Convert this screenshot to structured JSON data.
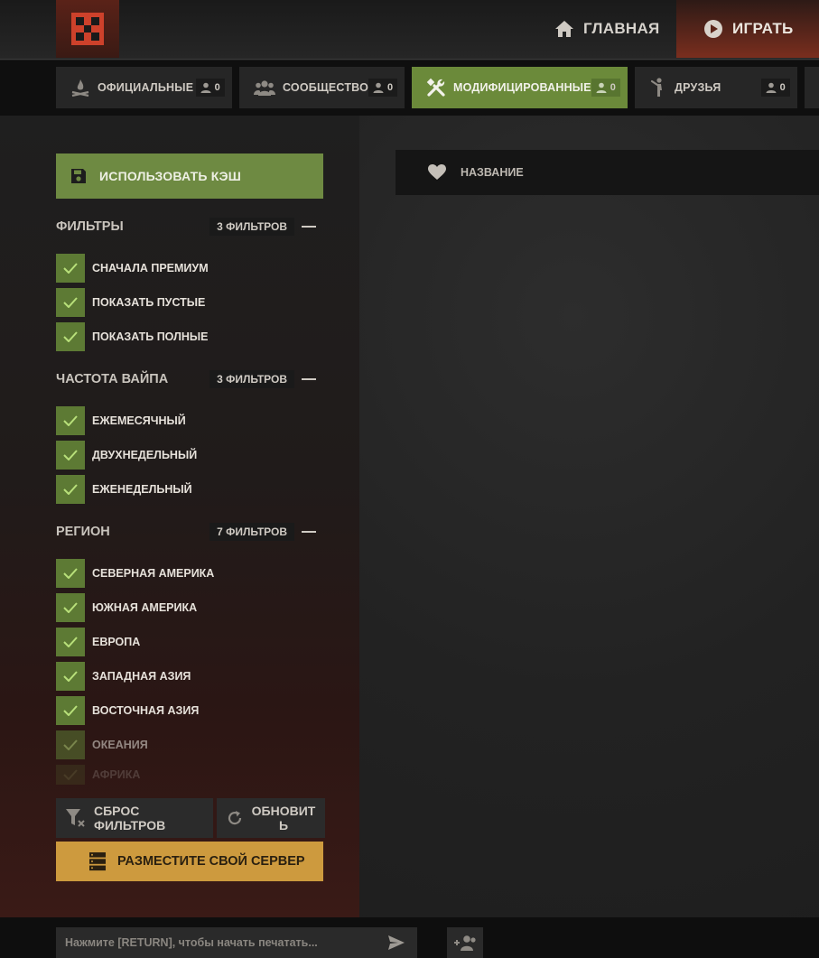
{
  "header": {
    "home_label": "ГЛАВНАЯ",
    "play_label": "ИГРАТЬ",
    "accent": "#cd412b"
  },
  "tabs": [
    {
      "label": "ОФИЦИАЛЬНЫЕ",
      "count": "0",
      "icon": "campfire-icon"
    },
    {
      "label": "СООБЩЕСТВО",
      "count": "0",
      "icon": "people-icon"
    },
    {
      "label": "МОДИФИЦИРОВАННЫЕ",
      "count": "0",
      "icon": "tools-icon",
      "active": true
    },
    {
      "label": "ДРУЗЬЯ",
      "count": "0",
      "icon": "waving-person-icon"
    }
  ],
  "sidebar": {
    "cache_button": "ИСПОЛЬЗОВАТЬ КЭШ",
    "filter_groups": [
      {
        "title": "ФИЛЬТРЫ",
        "count_label": "3 ФИЛЬТРОВ",
        "items": [
          "СНАЧАЛА ПРЕМИУМ",
          "ПОКАЗАТЬ ПУСТЫЕ",
          "ПОКАЗАТЬ ПОЛНЫЕ"
        ]
      },
      {
        "title": "ЧАСТОТА ВАЙПА",
        "count_label": "3 ФИЛЬТРОВ",
        "items": [
          "ЕЖЕМЕСЯЧНЫЙ",
          "ДВУХНЕДЕЛЬНЫЙ",
          "ЕЖЕНЕДЕЛЬНЫЙ"
        ]
      },
      {
        "title": "РЕГИОН",
        "count_label": "7 ФИЛЬТРОВ",
        "items": [
          "СЕВЕРНАЯ АМЕРИКА",
          "ЮЖНАЯ АМЕРИКА",
          "ЕВРОПА",
          "ЗАПАДНАЯ АЗИЯ",
          "ВОСТОЧНАЯ АЗИЯ",
          "ОКЕАНИЯ",
          "АФРИКА"
        ]
      }
    ],
    "reset_button": "СБРОС ФИЛЬТРОВ",
    "refresh_button": "ОБНОВИТЬ",
    "host_button": "РАЗМЕСТИТЕ СВОЙ СЕРВЕР",
    "accent_green": "#6e8a42",
    "accent_gold": "#cd9a3e"
  },
  "server_list": {
    "name_column": "НАЗВАНИЕ"
  },
  "chat": {
    "placeholder": "Нажмите [RETURN], чтобы начать печатать..."
  }
}
